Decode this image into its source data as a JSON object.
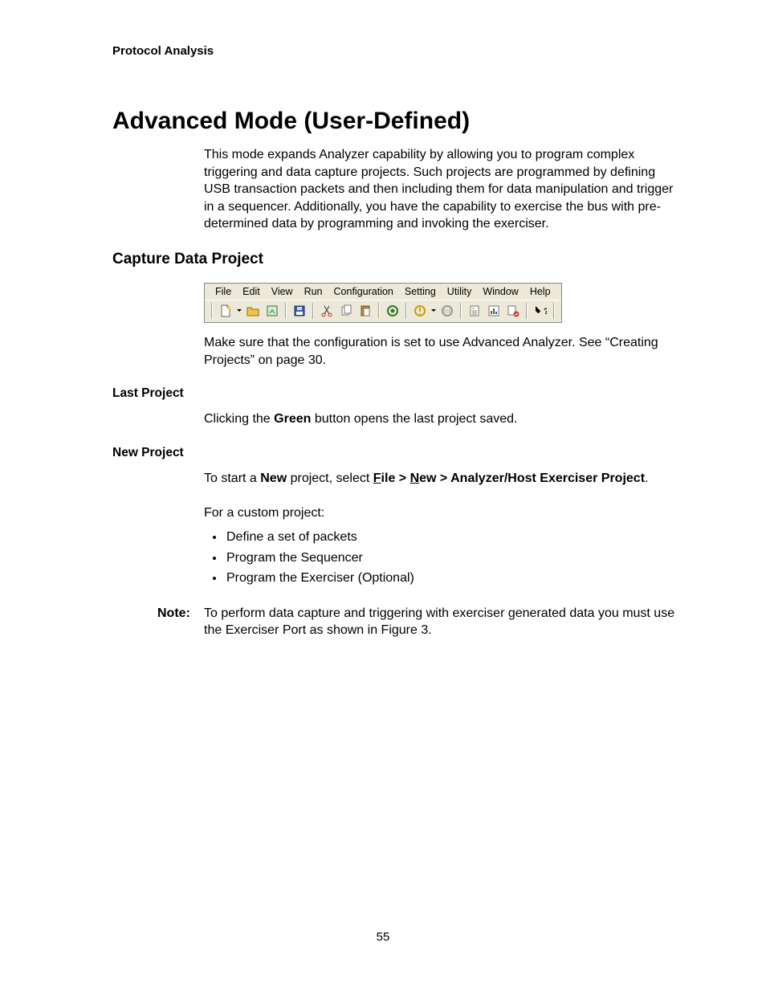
{
  "header": "Protocol Analysis",
  "title": "Advanced Mode (User-Defined)",
  "intro": "This mode expands Analyzer capability by allowing you to program complex triggering and data capture projects. Such projects are programmed by defining USB transaction packets and then including them for data manipulation and trigger in a sequencer. Additionally, you have the capability to exercise the bus with pre-determined data by programming and invoking the exerciser.",
  "section_title": "Capture Data Project",
  "menubar": [
    "File",
    "Edit",
    "View",
    "Run",
    "Configuration",
    "Setting",
    "Utility",
    "Window",
    "Help"
  ],
  "after_fig": "Make sure that the configuration is set to use Advanced Analyzer. See “Creating Projects” on page 30.",
  "last_project_heading": "Last Project",
  "last_project_body_pre": "Clicking the ",
  "last_project_body_bold": "Green",
  "last_project_body_post": " button opens the last project saved.",
  "new_project_heading": "New Project",
  "new_project_line_pre": "To start a ",
  "new_project_line_bold1": "New",
  "new_project_line_mid": " project, select ",
  "menu_file_u": "F",
  "menu_file_rest": "ile > ",
  "menu_new_u": "N",
  "menu_new_rest": "ew > Analyzer/Host Exerciser Project",
  "new_project_line_end": ".",
  "custom_intro": "For a custom project:",
  "bullets": [
    "Define a set of packets",
    "Program the Sequencer",
    "Program the Exerciser (Optional)"
  ],
  "note_label": "Note:",
  "note_body": "To perform data capture and triggering with exerciser generated data you must use the Exerciser Port as shown in Figure 3.",
  "page_number": "55"
}
